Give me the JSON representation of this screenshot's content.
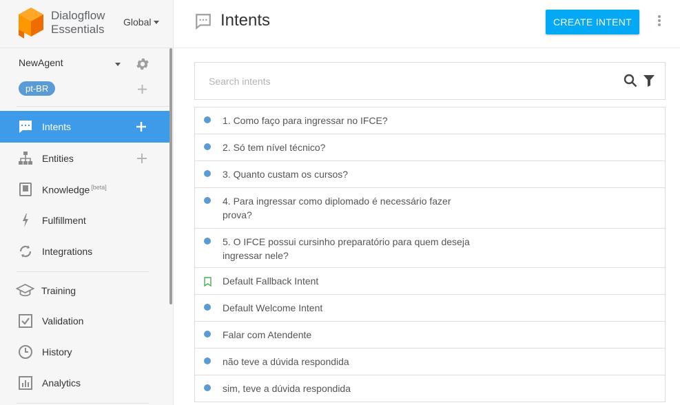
{
  "brand": {
    "line1": "Dialogflow",
    "line2": "Essentials",
    "region": "Global"
  },
  "agent": {
    "name": "NewAgent",
    "language": "pt-BR"
  },
  "nav": {
    "intents": "Intents",
    "entities": "Entities",
    "knowledge": "Knowledge",
    "knowledge_badge": "[beta]",
    "fulfillment": "Fulfillment",
    "integrations": "Integrations",
    "training": "Training",
    "validation": "Validation",
    "history": "History",
    "analytics": "Analytics"
  },
  "header": {
    "title": "Intents",
    "create_button": "CREATE INTENT"
  },
  "search": {
    "placeholder": "Search intents",
    "value": ""
  },
  "intents": [
    {
      "label": "1. Como faço para ingressar no IFCE?",
      "marker": "dot"
    },
    {
      "label": "2. Só tem nível técnico?",
      "marker": "dot"
    },
    {
      "label": "3. Quanto custam os cursos?",
      "marker": "dot"
    },
    {
      "label": "4. Para ingressar como diplomado é necessário fazer prova?",
      "marker": "dot"
    },
    {
      "label": "5. O IFCE possui cursinho preparatório para quem deseja ingressar nele?",
      "marker": "dot"
    },
    {
      "label": "Default Fallback Intent",
      "marker": "bookmark"
    },
    {
      "label": "Default Welcome Intent",
      "marker": "dot"
    },
    {
      "label": "Falar com Atendente",
      "marker": "dot"
    },
    {
      "label": "não teve a dúvida respondida",
      "marker": "dot"
    },
    {
      "label": "sim, teve a dúvida respondida",
      "marker": "dot"
    }
  ],
  "colors": {
    "accent": "#3d9be9",
    "button": "#03a9f4",
    "dot": "#5b9bd5",
    "logo": "#f57c00"
  }
}
